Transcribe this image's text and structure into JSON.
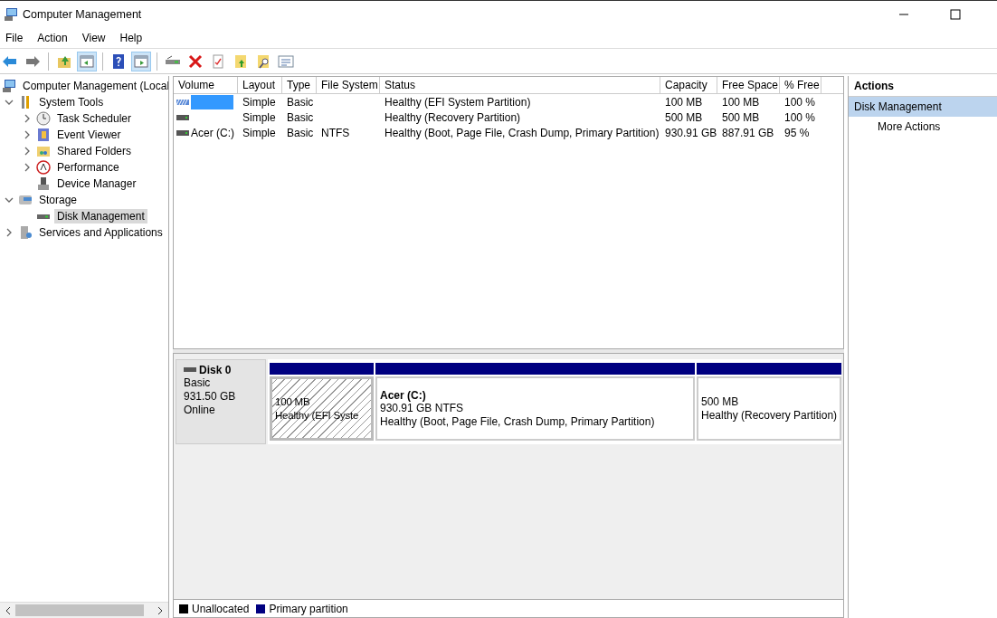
{
  "window": {
    "title": "Computer Management"
  },
  "menu": [
    "File",
    "Action",
    "View",
    "Help"
  ],
  "toolbar": [
    {
      "kind": "back",
      "pressed": false
    },
    {
      "kind": "forward",
      "pressed": false
    },
    {
      "kind": "separator"
    },
    {
      "kind": "up",
      "pressed": false
    },
    {
      "kind": "tree",
      "pressed": true
    },
    {
      "kind": "separator"
    },
    {
      "kind": "help",
      "pressed": false
    },
    {
      "kind": "pane",
      "pressed": true
    },
    {
      "kind": "separator"
    },
    {
      "kind": "drive",
      "pressed": false
    },
    {
      "kind": "delete",
      "pressed": false
    },
    {
      "kind": "check",
      "pressed": false
    },
    {
      "kind": "folder-up",
      "pressed": false
    },
    {
      "kind": "folder-search",
      "pressed": false
    },
    {
      "kind": "list",
      "pressed": false
    }
  ],
  "tree": [
    {
      "label": "Computer Management (Local",
      "kind": "computer",
      "selected": false,
      "children": [
        {
          "label": "System Tools",
          "kind": "tools",
          "expanded": true,
          "selected": false,
          "children": [
            {
              "label": "Task Scheduler",
              "kind": "clock",
              "expanded": false,
              "selected": false
            },
            {
              "label": "Event Viewer",
              "kind": "log",
              "expanded": false,
              "selected": false
            },
            {
              "label": "Shared Folders",
              "kind": "folder",
              "expanded": false,
              "selected": false
            },
            {
              "label": "Performance",
              "kind": "gauge",
              "expanded": false,
              "selected": false
            },
            {
              "label": "Device Manager",
              "kind": "device",
              "selected": false
            }
          ]
        },
        {
          "label": "Storage",
          "kind": "storage",
          "expanded": true,
          "selected": false,
          "children": [
            {
              "label": "Disk Management",
              "kind": "disk",
              "selected": true
            }
          ]
        },
        {
          "label": "Services and Applications",
          "kind": "services",
          "expanded": false,
          "selected": false
        }
      ]
    }
  ],
  "volumes": {
    "columns": [
      "Volume",
      "Layout",
      "Type",
      "File System",
      "Status",
      "Capacity",
      "Free Space",
      "% Free"
    ],
    "rows": [
      {
        "kind": "efi",
        "selected": true,
        "layout": "Simple",
        "type": "Basic",
        "status": "Healthy (EFI System Partition)",
        "capacity": "100 MB",
        "free_space": "100 MB",
        "pct_free": "100 %"
      },
      {
        "kind": "drive",
        "selected": false,
        "layout": "Simple",
        "type": "Basic",
        "status": "Healthy (Recovery Partition)",
        "capacity": "500 MB",
        "free_space": "500 MB",
        "pct_free": "100 %"
      },
      {
        "kind": "drive",
        "selected": false,
        "volume": "Acer (C:)",
        "layout": "Simple",
        "type": "Basic",
        "file_system": "NTFS",
        "status": "Healthy (Boot, Page File, Crash Dump, Primary Partition)",
        "capacity": "930.91 GB",
        "free_space": "887.91 GB",
        "pct_free": "95 %"
      }
    ]
  },
  "disk": {
    "name": "Disk 0",
    "type": "Basic",
    "size": "931.50 GB",
    "status": "Online",
    "partitions": [
      {
        "selected": true,
        "color": "#000080",
        "size": "100 MB",
        "status": "Healthy (EFI Syste"
      },
      {
        "selected": false,
        "color": "#000080",
        "name": "Acer  (C:)",
        "size": "930.91 GB NTFS",
        "status": "Healthy (Boot, Page File, Crash Dump, Primary Partition)"
      },
      {
        "selected": false,
        "color": "#000080",
        "size": "500 MB",
        "status": "Healthy (Recovery Partition)"
      }
    ]
  },
  "legend": [
    {
      "label": "Unallocated",
      "color": "#000000"
    },
    {
      "label": "Primary partition",
      "color": "#000080"
    }
  ],
  "actions": {
    "title": "Actions",
    "section": "Disk Management",
    "items": [
      "More Actions"
    ]
  }
}
